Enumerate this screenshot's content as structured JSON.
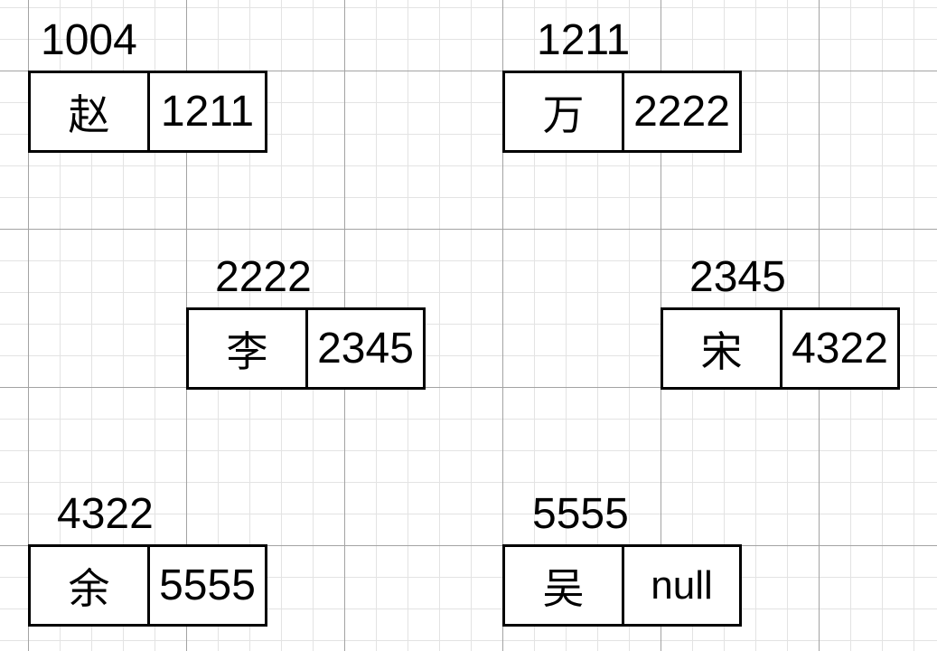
{
  "nodes": [
    {
      "address": "1004",
      "name": "赵",
      "next": "1211"
    },
    {
      "address": "1211",
      "name": "万",
      "next": "2222"
    },
    {
      "address": "2222",
      "name": "李",
      "next": "2345"
    },
    {
      "address": "2345",
      "name": "宋",
      "next": "4322"
    },
    {
      "address": "4322",
      "name": "余",
      "next": "5555"
    },
    {
      "address": "5555",
      "name": "吴",
      "next": "null"
    }
  ]
}
